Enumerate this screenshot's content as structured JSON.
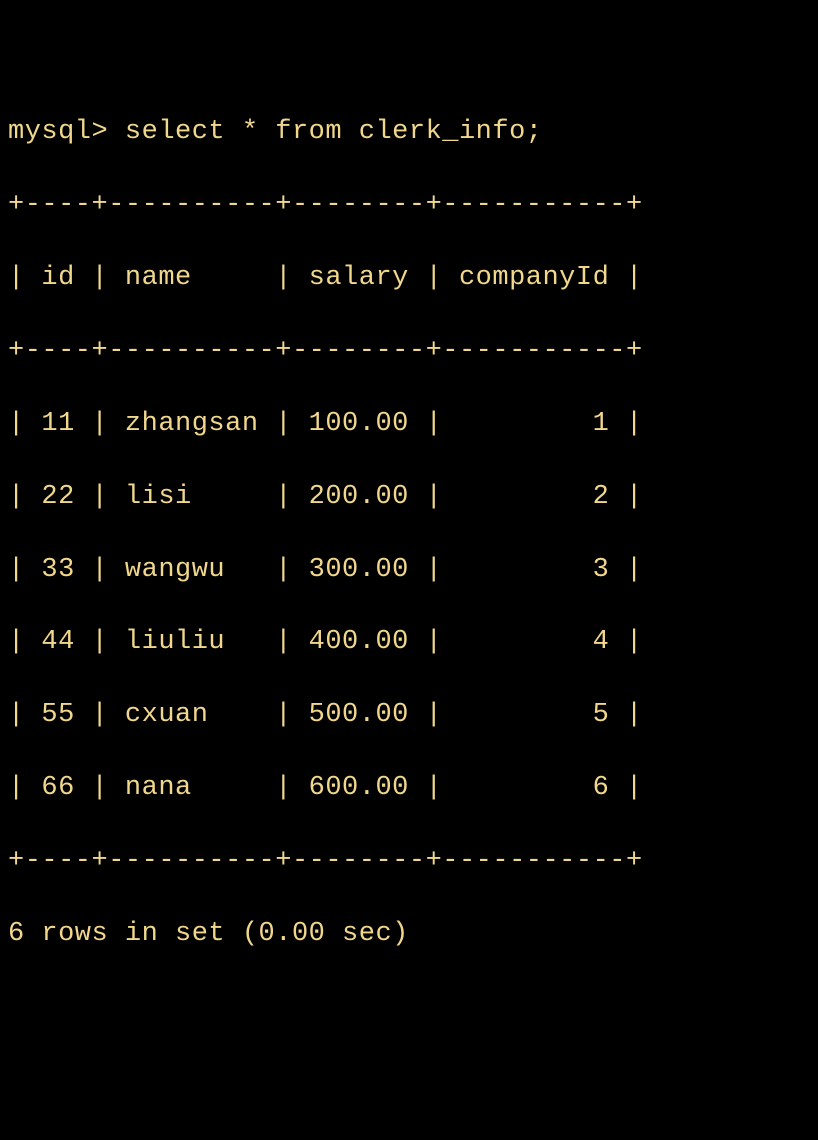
{
  "prompt": "mysql> ",
  "query": "select * from clerk_info;",
  "table": {
    "border": "+----+----------+--------+-----------+",
    "columns": [
      "id",
      "name",
      "salary",
      "companyId"
    ],
    "headerRow": "| id | name     | salary | companyId |",
    "rows": [
      {
        "id": "11",
        "name": "zhangsan",
        "salary": "100.00",
        "companyId": "1"
      },
      {
        "id": "22",
        "name": "lisi",
        "salary": "200.00",
        "companyId": "2"
      },
      {
        "id": "33",
        "name": "wangwu",
        "salary": "300.00",
        "companyId": "3"
      },
      {
        "id": "44",
        "name": "liuliu",
        "salary": "400.00",
        "companyId": "4"
      },
      {
        "id": "55",
        "name": "cxuan",
        "salary": "500.00",
        "companyId": "5"
      },
      {
        "id": "66",
        "name": "nana",
        "salary": "600.00",
        "companyId": "6"
      }
    ],
    "dataRowsRaw": [
      "| 11 | zhangsan | 100.00 |         1 |",
      "| 22 | lisi     | 200.00 |         2 |",
      "| 33 | wangwu   | 300.00 |         3 |",
      "| 44 | liuliu   | 400.00 |         4 |",
      "| 55 | cxuan    | 500.00 |         5 |",
      "| 66 | nana     | 600.00 |         6 |"
    ]
  },
  "footer": "6 rows in set (0.00 sec)"
}
